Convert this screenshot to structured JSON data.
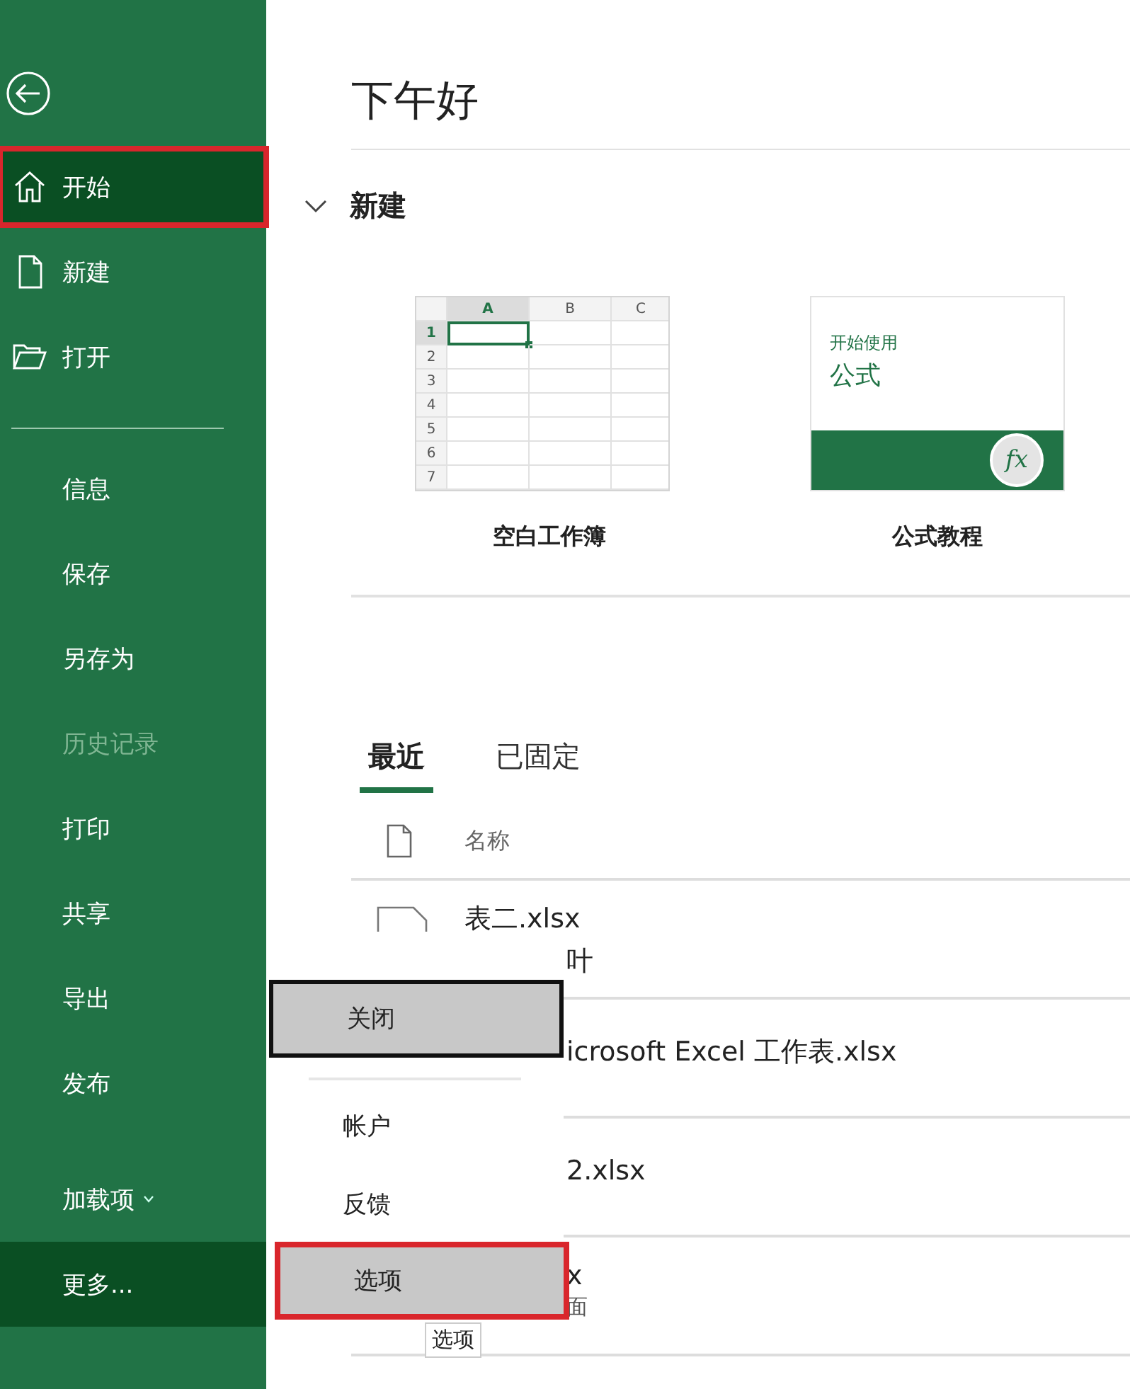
{
  "sidebar": {
    "top_items": [
      {
        "label": "开始",
        "kind": "home",
        "selected": true,
        "annotated": true
      },
      {
        "label": "新建",
        "kind": "file",
        "selected": false,
        "annotated": false
      },
      {
        "label": "打开",
        "kind": "folder",
        "selected": false,
        "annotated": false
      }
    ],
    "items": [
      {
        "label": "信息",
        "selected": false,
        "disabled": false,
        "dropdown": false
      },
      {
        "label": "保存",
        "selected": false,
        "disabled": false,
        "dropdown": false
      },
      {
        "label": "另存为",
        "selected": false,
        "disabled": false,
        "dropdown": false
      },
      {
        "label": "历史记录",
        "selected": false,
        "disabled": true,
        "dropdown": false
      },
      {
        "label": "打印",
        "selected": false,
        "disabled": false,
        "dropdown": false
      },
      {
        "label": "共享",
        "selected": false,
        "disabled": false,
        "dropdown": false
      },
      {
        "label": "导出",
        "selected": false,
        "disabled": false,
        "dropdown": false
      },
      {
        "label": "发布",
        "selected": false,
        "disabled": false,
        "dropdown": false
      },
      {
        "label": "加载项",
        "selected": false,
        "disabled": false,
        "dropdown": true
      },
      {
        "label": "更多...",
        "selected": true,
        "disabled": false,
        "dropdown": false
      }
    ]
  },
  "greeting": "下午好",
  "new_section": {
    "title": "新建",
    "expanded": true,
    "blank_workbook": {
      "label": "空白工作簿",
      "columns": [
        {
          "label": "A",
          "selected": true
        },
        {
          "label": "B",
          "selected": false
        },
        {
          "label": "C",
          "selected": false
        }
      ],
      "rows": [
        {
          "label": "1",
          "selected": true
        },
        {
          "label": "2",
          "selected": false
        },
        {
          "label": "3",
          "selected": false
        },
        {
          "label": "4",
          "selected": false
        },
        {
          "label": "5",
          "selected": false
        },
        {
          "label": "6",
          "selected": false
        },
        {
          "label": "7",
          "selected": false
        }
      ]
    },
    "formula_tutorial": {
      "label": "公式教程",
      "subtitle": "开始使用",
      "title": "公式",
      "badge": "fx"
    }
  },
  "tabs": [
    {
      "label": "最近",
      "selected": true
    },
    {
      "label": "已固定",
      "selected": false
    }
  ],
  "file_list": {
    "column": "名称",
    "rows": [
      {
        "kind": "full",
        "name": "表二.xlsx"
      },
      {
        "kind": "partial",
        "name": "叶"
      },
      {
        "kind": "partial",
        "name": "icrosoft Excel 工作表.xlsx"
      },
      {
        "kind": "partial",
        "name": "2.xlsx"
      },
      {
        "kind": "partial",
        "name": "x",
        "sub": "面"
      }
    ]
  },
  "more_menu": {
    "items": [
      {
        "label": "关闭",
        "selected": true,
        "focused": true,
        "annotated": false
      },
      {
        "label": "帐户",
        "selected": false,
        "focused": false,
        "annotated": false
      },
      {
        "label": "反馈",
        "selected": false,
        "focused": false,
        "annotated": false
      },
      {
        "label": "选项",
        "selected": true,
        "focused": false,
        "annotated": true
      }
    ],
    "tooltip": "选项"
  }
}
